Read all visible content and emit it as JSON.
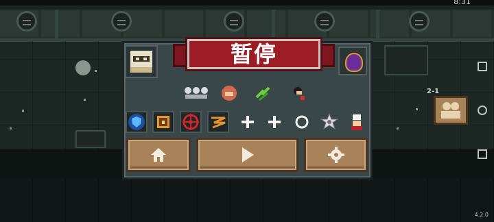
{
  "pause_menu": {
    "title": "暂停",
    "buffs": [
      "skeleton-group-icon",
      "helmet-buff-icon",
      "green-arrows-icon",
      "mercenary-icon"
    ],
    "items": [
      "shield-skill-icon",
      "backpack-icon",
      "crosshair-icon",
      "lightning-icon",
      "plus-icon",
      "plus-icon",
      "ring-icon",
      "star-badge-icon",
      "chef-icon"
    ],
    "buttons": {
      "home": "home-icon",
      "resume": "play-icon",
      "settings": "gear-icon"
    }
  },
  "hud": {
    "clock": "8:31",
    "level": "2-1",
    "version": "4.2.0"
  },
  "colors": {
    "banner": "#9c1d26",
    "button": "#a8835a",
    "panel": "#3a4749"
  }
}
